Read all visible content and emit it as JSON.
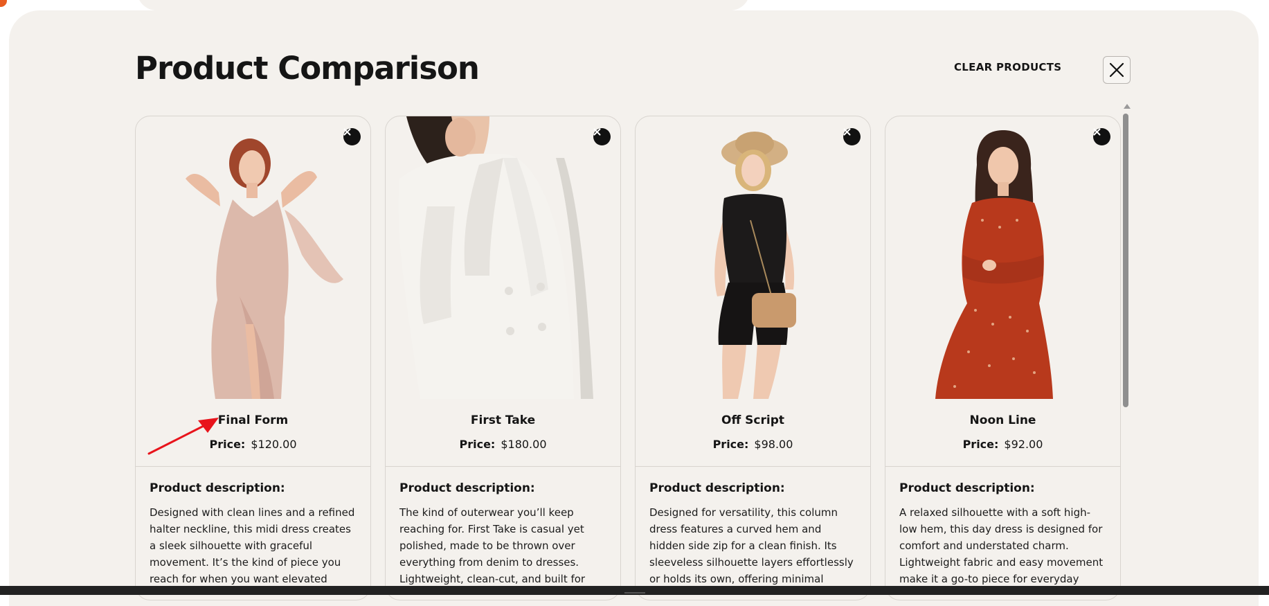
{
  "modal": {
    "title": "Product Comparison",
    "clear_label": "CLEAR PRODUCTS",
    "close_icon": "close-x-icon"
  },
  "colors": {
    "background": "#f4f1ed",
    "text": "#151515",
    "remove_button": "#111111",
    "annotation_arrow": "#e8141c"
  },
  "products": [
    {
      "name": "Final Form",
      "price_label": "Price:",
      "price": "$120.00",
      "desc_title": "Product description:",
      "description": "Designed with clean lines and a refined halter neckline, this midi dress creates a sleek silhouette with graceful movement. It’s the kind of piece you reach for when you want elevated"
    },
    {
      "name": "First Take",
      "price_label": "Price:",
      "price": "$180.00",
      "desc_title": "Product description:",
      "description": "The kind of outerwear you’ll keep reaching for. First Take is casual yet polished, made to be thrown over everything from denim to dresses. Lightweight, clean-cut, and built for"
    },
    {
      "name": "Off Script",
      "price_label": "Price:",
      "price": "$98.00",
      "desc_title": "Product description:",
      "description": "Designed for versatility, this column dress features a curved hem and hidden side zip for a clean finish. Its sleeveless silhouette layers effortlessly or holds its own, offering minimal"
    },
    {
      "name": "Noon Line",
      "price_label": "Price:",
      "price": "$92.00",
      "desc_title": "Product description:",
      "description": "A relaxed silhouette with a soft high-low hem, this day dress is designed for comfort and understated charm. Lightweight fabric and easy movement make it a go-to piece for everyday"
    }
  ]
}
